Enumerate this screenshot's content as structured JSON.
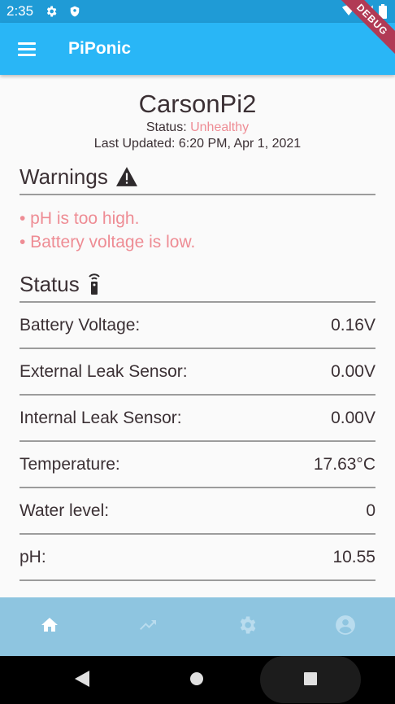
{
  "status_bar": {
    "time": "2:35"
  },
  "app_bar": {
    "title": "PiPonic",
    "debug_banner": "DEBUG"
  },
  "device": {
    "name": "CarsonPi2",
    "status_label": "Status: ",
    "status_value": "Unhealthy",
    "last_updated": "Last Updated: 6:20 PM, Apr 1, 2021"
  },
  "warnings": {
    "heading": "Warnings",
    "items": [
      "• pH is too high.",
      "• Battery voltage is low."
    ]
  },
  "status": {
    "heading": "Status",
    "rows": [
      {
        "label": "Battery Voltage:",
        "value": "0.16V"
      },
      {
        "label": "External Leak Sensor:",
        "value": "0.00V"
      },
      {
        "label": "Internal Leak Sensor:",
        "value": "0.00V"
      },
      {
        "label": "Temperature:",
        "value": "17.63°C"
      },
      {
        "label": "Water level:",
        "value": "0"
      },
      {
        "label": "pH:",
        "value": "10.55"
      }
    ]
  },
  "bottom_nav": {
    "items": [
      {
        "icon": "home-icon",
        "active": true
      },
      {
        "icon": "trending-icon",
        "active": false
      },
      {
        "icon": "settings-icon",
        "active": false
      },
      {
        "icon": "account-icon",
        "active": false
      }
    ]
  },
  "colors": {
    "app_bar": "#29b6f6",
    "status_bar": "#1f9bd6",
    "bottom_nav": "#8ec5e0",
    "warning_text": "#ee8c94"
  }
}
